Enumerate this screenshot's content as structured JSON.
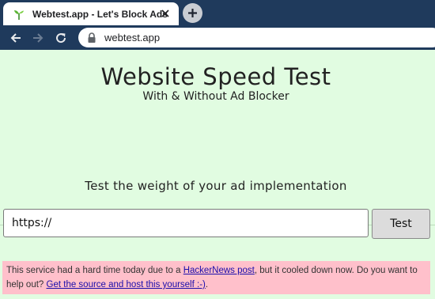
{
  "browser": {
    "tab_title": "Webtest.app - Let's Block Ads",
    "address": "webtest.app"
  },
  "page": {
    "heading": "Website Speed Test",
    "subheading": "With & Without Ad Blocker",
    "tagline": "Test the weight of your ad implementation",
    "url_input_value": "https://",
    "test_button": "Test",
    "notice": {
      "text_1": "This service had a hard time today due to a ",
      "link_1": "HackerNews post",
      "text_2": ", but it cooled down now. Do you want to help out? ",
      "link_2": "Get the source and host this yourself :-)",
      "text_3": "."
    }
  },
  "colors": {
    "chrome": "#1f3a5c",
    "page_background": "#e1fce1",
    "notice_background": "#ffc0cb",
    "link": "#1a0dab"
  },
  "icons": {
    "favicon": "sprout-icon",
    "tab_close": "close-icon",
    "new_tab": "plus-icon",
    "back": "arrow-left-icon",
    "forward": "arrow-right-icon",
    "reload": "reload-icon",
    "secure": "lock-icon"
  }
}
